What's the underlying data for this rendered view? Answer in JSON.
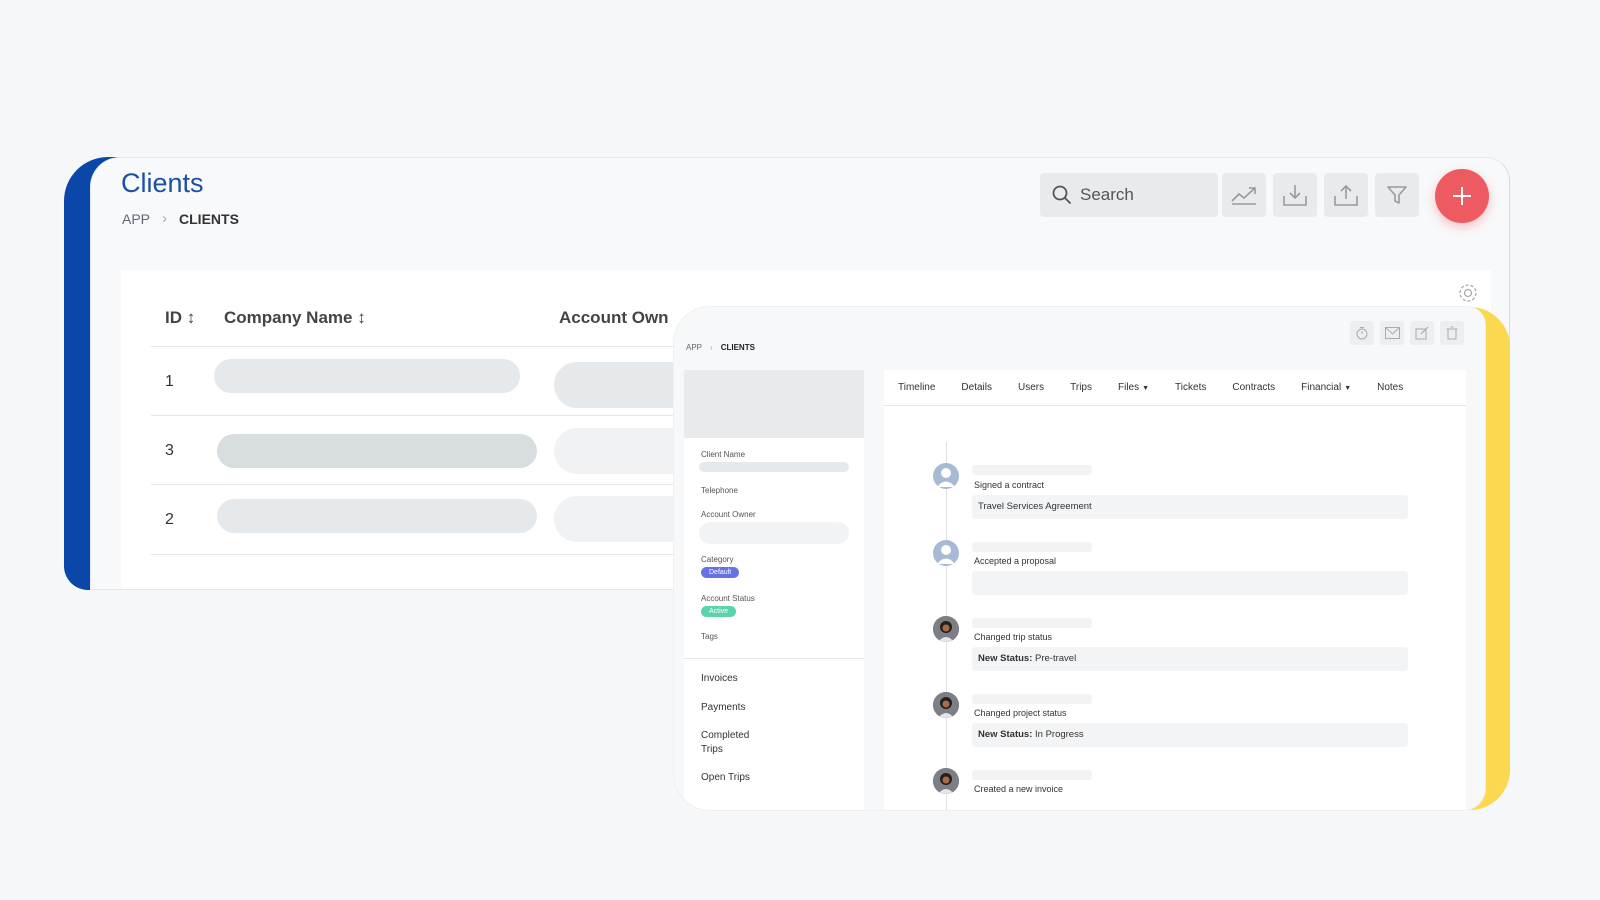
{
  "page": {
    "title": "Clients",
    "breadcrumb": [
      "APP",
      "CLIENTS"
    ]
  },
  "toolbar": {
    "search_placeholder": "Search",
    "icons": [
      "search-icon",
      "chart-icon",
      "download-icon",
      "upload-icon",
      "filter-icon",
      "plus-icon"
    ]
  },
  "table": {
    "columns": [
      "ID ↕",
      "Company Name ↕",
      "Account Own"
    ],
    "rows": [
      {
        "id": "1"
      },
      {
        "id": "3"
      },
      {
        "id": "2"
      }
    ]
  },
  "detail": {
    "breadcrumb": [
      "APP",
      "CLIENTS"
    ],
    "side_labels": {
      "client_name": "Client Name",
      "telephone": "Telephone",
      "account_owner": "Account Owner",
      "category": "Category",
      "account_status": "Account Status",
      "tags": "Tags"
    },
    "badges": {
      "category": "Default",
      "status": "Active",
      "category_color": "#6772e5",
      "status_color": "#5dd3a9"
    },
    "side_links": [
      "Invoices",
      "Payments",
      "Completed Trips",
      "Open Trips"
    ],
    "tabs": [
      "Timeline",
      "Details",
      "Users",
      "Trips",
      "Files",
      "Tickets",
      "Contracts",
      "Financial",
      "Notes"
    ],
    "timeline": [
      {
        "title": "Signed a contract",
        "box_label": "",
        "box_text": "Travel Services Agreement"
      },
      {
        "title": "Accepted a proposal",
        "box_label": "",
        "box_text": ""
      },
      {
        "title": "Changed trip status",
        "box_label": "New Status:",
        "box_text": "Pre-travel"
      },
      {
        "title": "Changed project status",
        "box_label": "New Status:",
        "box_text": "In Progress"
      },
      {
        "title": "Created a new invoice",
        "box_label": "",
        "box_text": ""
      }
    ]
  },
  "colors": {
    "brand_blue": "#0a47a9",
    "title_blue": "#1d4fa3",
    "accent_red": "#ee5a62",
    "accent_yellow": "#fcd851"
  }
}
